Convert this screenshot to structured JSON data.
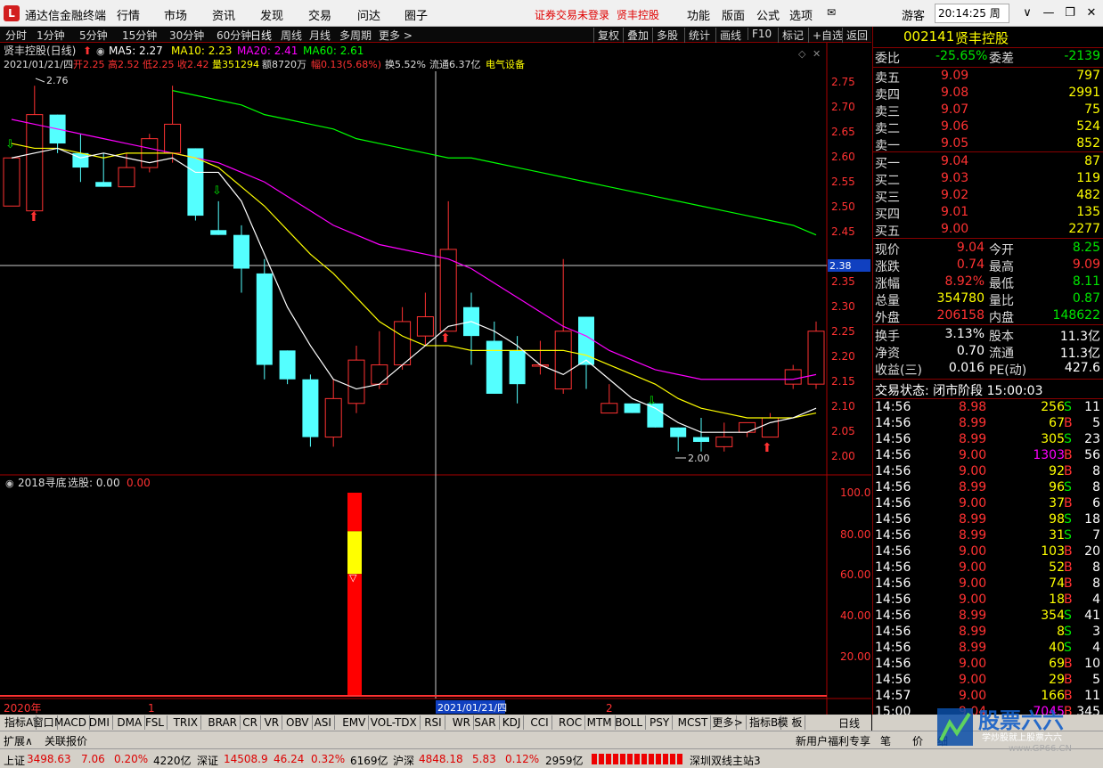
{
  "app": {
    "title": "通达信金融终端",
    "login_notice": "证券交易未登录",
    "stock_link": "贤丰控股",
    "time": "20:14:25 周一"
  },
  "menu": [
    "行情",
    "市场",
    "资讯",
    "发现",
    "交易",
    "问达",
    "圈子"
  ],
  "menu_right": [
    "功能",
    "版面",
    "公式",
    "选项",
    "游客"
  ],
  "periods": [
    "分时",
    "1分钟",
    "5分钟",
    "15分钟",
    "30分钟",
    "60分钟",
    "日线",
    "周线",
    "月线",
    "多周期",
    "更多 >"
  ],
  "active_period": "日线",
  "toolbar_right": [
    "复权",
    "叠加",
    "多股",
    "统计",
    "画线",
    "F10",
    "标记",
    "+自选",
    "返回"
  ],
  "chart_header": {
    "name": "贤丰控股(日线)",
    "ma5": "MA5: 2.27",
    "ma10": "MA10: 2.23",
    "ma20": "MA20: 2.41",
    "ma60": "MA60: 2.61",
    "date": "2021/01/21/四",
    "open": "开2.25",
    "high": "高2.52",
    "low": "低2.25",
    "close": "收2.42",
    "vol": "量351294",
    "amount": "额8720万",
    "change": "幅0.13(5.68%)",
    "turnover": "换5.52%",
    "float": "流通6.37亿",
    "industry": "电气设备"
  },
  "price_axis": [
    "2.75",
    "2.70",
    "2.65",
    "2.60",
    "2.55",
    "2.50",
    "2.45",
    "2.40",
    "2.35",
    "2.30",
    "2.25",
    "2.20",
    "2.15",
    "2.10",
    "2.05",
    "2.00"
  ],
  "crosshair_price": "2.38",
  "max_label": "2.76",
  "min_label": "2.00",
  "indicator_header": {
    "name": "2018寻底",
    "pick": "选股: 0.00",
    "value": "0.00"
  },
  "indicator_axis": [
    "100.0",
    "80.00",
    "60.00",
    "40.00",
    "20.00"
  ],
  "date_axis": {
    "year": "2020年",
    "m1": "1",
    "cross": "2021/01/21/四",
    "m2": "2"
  },
  "chart_data": {
    "type": "candlestick",
    "candles": [
      {
        "o": 2.51,
        "h": 2.61,
        "l": 2.51,
        "c": 2.61
      },
      {
        "o": 2.5,
        "h": 2.76,
        "l": 2.49,
        "c": 2.7
      },
      {
        "o": 2.7,
        "h": 2.7,
        "l": 2.62,
        "c": 2.64
      },
      {
        "o": 2.62,
        "h": 2.66,
        "l": 2.56,
        "c": 2.59
      },
      {
        "o": 2.56,
        "h": 2.62,
        "l": 2.55,
        "c": 2.55
      },
      {
        "o": 2.55,
        "h": 2.62,
        "l": 2.55,
        "c": 2.59
      },
      {
        "o": 2.59,
        "h": 2.66,
        "l": 2.58,
        "c": 2.65
      },
      {
        "o": 2.62,
        "h": 2.76,
        "l": 2.6,
        "c": 2.68
      },
      {
        "o": 2.63,
        "h": 2.63,
        "l": 2.48,
        "c": 2.49
      },
      {
        "o": 2.46,
        "h": 2.52,
        "l": 2.45,
        "c": 2.45
      },
      {
        "o": 2.45,
        "h": 2.47,
        "l": 2.33,
        "c": 2.38
      },
      {
        "o": 2.37,
        "h": 2.4,
        "l": 2.15,
        "c": 2.18
      },
      {
        "o": 2.21,
        "h": 2.21,
        "l": 2.14,
        "c": 2.15
      },
      {
        "o": 2.15,
        "h": 2.16,
        "l": 2.01,
        "c": 2.03
      },
      {
        "o": 2.03,
        "h": 2.15,
        "l": 2.01,
        "c": 2.11
      },
      {
        "o": 2.1,
        "h": 2.22,
        "l": 2.08,
        "c": 2.19
      },
      {
        "o": 2.14,
        "h": 2.25,
        "l": 2.13,
        "c": 2.18
      },
      {
        "o": 2.18,
        "h": 2.3,
        "l": 2.17,
        "c": 2.27
      },
      {
        "o": 2.24,
        "h": 2.33,
        "l": 2.22,
        "c": 2.28
      },
      {
        "o": 2.25,
        "h": 2.52,
        "l": 2.25,
        "c": 2.42
      },
      {
        "o": 2.3,
        "h": 2.33,
        "l": 2.18,
        "c": 2.24
      },
      {
        "o": 2.23,
        "h": 2.27,
        "l": 2.12,
        "c": 2.12
      },
      {
        "o": 2.21,
        "h": 2.24,
        "l": 2.1,
        "c": 2.14
      },
      {
        "o": 2.18,
        "h": 2.23,
        "l": 2.16,
        "c": 2.18
      },
      {
        "o": 2.13,
        "h": 2.4,
        "l": 2.12,
        "c": 2.25
      },
      {
        "o": 2.28,
        "h": 2.28,
        "l": 2.13,
        "c": 2.18
      },
      {
        "o": 2.08,
        "h": 2.14,
        "l": 2.08,
        "c": 2.1
      },
      {
        "o": 2.1,
        "h": 2.1,
        "l": 2.08,
        "c": 2.08
      },
      {
        "o": 2.1,
        "h": 2.1,
        "l": 2.05,
        "c": 2.05
      },
      {
        "o": 2.05,
        "h": 2.05,
        "l": 2.0,
        "c": 2.03
      },
      {
        "o": 2.03,
        "h": 2.07,
        "l": 2.0,
        "c": 2.02
      },
      {
        "o": 2.01,
        "h": 2.06,
        "l": 2.0,
        "c": 2.03
      },
      {
        "o": 2.04,
        "h": 2.06,
        "l": 2.03,
        "c": 2.06
      },
      {
        "o": 2.03,
        "h": 2.08,
        "l": 2.03,
        "c": 2.07
      },
      {
        "o": 2.14,
        "h": 2.18,
        "l": 2.13,
        "c": 2.17
      },
      {
        "o": 2.14,
        "h": 2.27,
        "l": 2.13,
        "c": 2.25
      }
    ],
    "ma5": [
      2.61,
      2.62,
      2.63,
      2.61,
      2.62,
      2.61,
      2.6,
      2.61,
      2.58,
      2.58,
      2.52,
      2.41,
      2.3,
      2.22,
      2.15,
      2.13,
      2.14,
      2.18,
      2.22,
      2.26,
      2.27,
      2.25,
      2.22,
      2.18,
      2.16,
      2.19,
      2.15,
      2.11,
      2.09,
      2.06,
      2.04,
      2.04,
      2.04,
      2.06,
      2.07,
      2.09
    ],
    "ma10": [
      2.64,
      2.63,
      2.63,
      2.62,
      2.61,
      2.62,
      2.62,
      2.62,
      2.61,
      2.59,
      2.55,
      2.51,
      2.46,
      2.41,
      2.37,
      2.32,
      2.27,
      2.24,
      2.22,
      2.22,
      2.21,
      2.21,
      2.21,
      2.21,
      2.21,
      2.2,
      2.18,
      2.16,
      2.14,
      2.11,
      2.09,
      2.08,
      2.07,
      2.07,
      2.07,
      2.08
    ],
    "ma20": [
      2.69,
      2.68,
      2.67,
      2.66,
      2.65,
      2.64,
      2.63,
      2.62,
      2.61,
      2.6,
      2.58,
      2.56,
      2.53,
      2.5,
      2.47,
      2.45,
      2.43,
      2.42,
      2.41,
      2.4,
      2.38,
      2.35,
      2.32,
      2.29,
      2.26,
      2.24,
      2.21,
      2.19,
      2.17,
      2.16,
      2.15,
      2.15,
      2.15,
      2.15,
      2.15,
      2.16
    ],
    "ma60": [
      2.83,
      2.82,
      2.8,
      2.79,
      2.77,
      2.76,
      2.75,
      2.75,
      2.74,
      2.73,
      2.72,
      2.7,
      2.69,
      2.68,
      2.67,
      2.65,
      2.64,
      2.63,
      2.62,
      2.61,
      2.61,
      2.6,
      2.59,
      2.58,
      2.57,
      2.56,
      2.55,
      2.54,
      2.53,
      2.52,
      2.51,
      2.5,
      2.49,
      2.48,
      2.47,
      2.45
    ],
    "indicator": {
      "index": 19,
      "levels": [
        100,
        81,
        60,
        0
      ]
    },
    "ylim": [
      1.97,
      2.79
    ],
    "colors": {
      "up": "#ff3232",
      "down": "#54ffff",
      "ma5": "#ffffff",
      "ma10": "#ffff00",
      "ma20": "#ff00ff",
      "ma60": "#00ff00"
    }
  },
  "quote": {
    "code": "002141",
    "name": "贤丰控股",
    "weibi_label": "委比",
    "weibi": "-25.65%",
    "weicha_label": "委差",
    "weicha": "-2139",
    "asks": [
      {
        "label": "卖五",
        "price": "9.09",
        "vol": "797"
      },
      {
        "label": "卖四",
        "price": "9.08",
        "vol": "2991"
      },
      {
        "label": "卖三",
        "price": "9.07",
        "vol": "75"
      },
      {
        "label": "卖二",
        "price": "9.06",
        "vol": "524"
      },
      {
        "label": "卖一",
        "price": "9.05",
        "vol": "852"
      }
    ],
    "bids": [
      {
        "label": "买一",
        "price": "9.04",
        "vol": "87"
      },
      {
        "label": "买二",
        "price": "9.03",
        "vol": "119"
      },
      {
        "label": "买三",
        "price": "9.02",
        "vol": "482"
      },
      {
        "label": "买四",
        "price": "9.01",
        "vol": "135"
      },
      {
        "label": "买五",
        "price": "9.00",
        "vol": "2277"
      }
    ],
    "stats": [
      {
        "l1": "现价",
        "v1": "9.04",
        "c1": "red",
        "l2": "今开",
        "v2": "8.25",
        "c2": "green"
      },
      {
        "l1": "涨跌",
        "v1": "0.74",
        "c1": "red",
        "l2": "最高",
        "v2": "9.09",
        "c2": "red"
      },
      {
        "l1": "涨幅",
        "v1": "8.92%",
        "c1": "red",
        "l2": "最低",
        "v2": "8.11",
        "c2": "green"
      },
      {
        "l1": "总量",
        "v1": "354780",
        "c1": "yellow",
        "l2": "量比",
        "v2": "0.87",
        "c2": "green"
      },
      {
        "l1": "外盘",
        "v1": "206158",
        "c1": "red",
        "l2": "内盘",
        "v2": "148622",
        "c2": "green"
      }
    ],
    "fin": [
      {
        "l1": "换手",
        "v1": "3.13%",
        "l2": "股本",
        "v2": "11.3亿"
      },
      {
        "l1": "净资",
        "v1": "0.70",
        "l2": "流通",
        "v2": "11.3亿"
      },
      {
        "l1": "收益(三)",
        "v1": "0.016",
        "l2": "PE(动)",
        "v2": "427.6"
      }
    ],
    "trade_status": "交易状态: 闭市阶段  15:00:03",
    "ticks": [
      {
        "t": "14:56",
        "p": "8.98",
        "pc": "red",
        "v": "256",
        "vc": "yellow",
        "s": "S",
        "n": "11"
      },
      {
        "t": "14:56",
        "p": "8.99",
        "pc": "red",
        "v": "67",
        "vc": "yellow",
        "s": "B",
        "n": "5"
      },
      {
        "t": "14:56",
        "p": "8.99",
        "pc": "red",
        "v": "305",
        "vc": "yellow",
        "s": "S",
        "n": "23"
      },
      {
        "t": "14:56",
        "p": "9.00",
        "pc": "red",
        "v": "1303",
        "vc": "magenta",
        "s": "B",
        "n": "56"
      },
      {
        "t": "14:56",
        "p": "9.00",
        "pc": "red",
        "v": "92",
        "vc": "yellow",
        "s": "B",
        "n": "8"
      },
      {
        "t": "14:56",
        "p": "8.99",
        "pc": "red",
        "v": "96",
        "vc": "yellow",
        "s": "S",
        "n": "8"
      },
      {
        "t": "14:56",
        "p": "9.00",
        "pc": "red",
        "v": "37",
        "vc": "yellow",
        "s": "B",
        "n": "6"
      },
      {
        "t": "14:56",
        "p": "8.99",
        "pc": "red",
        "v": "98",
        "vc": "yellow",
        "s": "S",
        "n": "18"
      },
      {
        "t": "14:56",
        "p": "8.99",
        "pc": "red",
        "v": "31",
        "vc": "yellow",
        "s": "S",
        "n": "7"
      },
      {
        "t": "14:56",
        "p": "9.00",
        "pc": "red",
        "v": "103",
        "vc": "yellow",
        "s": "B",
        "n": "20"
      },
      {
        "t": "14:56",
        "p": "9.00",
        "pc": "red",
        "v": "52",
        "vc": "yellow",
        "s": "B",
        "n": "8"
      },
      {
        "t": "14:56",
        "p": "9.00",
        "pc": "red",
        "v": "74",
        "vc": "yellow",
        "s": "B",
        "n": "8"
      },
      {
        "t": "14:56",
        "p": "9.00",
        "pc": "red",
        "v": "18",
        "vc": "yellow",
        "s": "B",
        "n": "4"
      },
      {
        "t": "14:56",
        "p": "8.99",
        "pc": "red",
        "v": "354",
        "vc": "yellow",
        "s": "S",
        "n": "41"
      },
      {
        "t": "14:56",
        "p": "8.99",
        "pc": "red",
        "v": "8",
        "vc": "yellow",
        "s": "S",
        "n": "3"
      },
      {
        "t": "14:56",
        "p": "8.99",
        "pc": "red",
        "v": "40",
        "vc": "yellow",
        "s": "S",
        "n": "4"
      },
      {
        "t": "14:56",
        "p": "9.00",
        "pc": "red",
        "v": "69",
        "vc": "yellow",
        "s": "B",
        "n": "10"
      },
      {
        "t": "14:56",
        "p": "9.00",
        "pc": "red",
        "v": "29",
        "vc": "yellow",
        "s": "B",
        "n": "5"
      },
      {
        "t": "14:57",
        "p": "9.00",
        "pc": "red",
        "v": "166",
        "vc": "yellow",
        "s": "B",
        "n": "11"
      },
      {
        "t": "15:00",
        "p": "9.04",
        "pc": "red",
        "v": "7045",
        "vc": "magenta",
        "s": "B",
        "n": "345"
      }
    ]
  },
  "indicator_tabs": [
    "指标A",
    "窗口",
    "MACD",
    "DMI",
    "DMA",
    "FSL",
    "TRIX",
    "BRAR",
    "CR",
    "VR",
    "OBV",
    "ASI",
    "EMV",
    "VOL-TDX",
    "RSI",
    "WR",
    "SAR",
    "KDJ",
    "CCI",
    "ROC",
    "MTM",
    "BOLL",
    "PSY",
    "MCST",
    "更多",
    ">",
    "指标B",
    "模 板"
  ],
  "right_tabs": {
    "period": "日线"
  },
  "ext": {
    "expand": "扩展∧",
    "related": "关联报价",
    "promo": "新用户福利专享",
    "tab1": "笔",
    "tab2": "价",
    "tab3": "细"
  },
  "status": {
    "sh_label": "上证",
    "sh": "3498.63",
    "sh_chg": "7.06",
    "sh_pct": "0.20%",
    "sh_amt": "4220亿",
    "sz_label": "深证",
    "sz": "14508.9",
    "sz_chg": "46.24",
    "sz_pct": "0.32%",
    "sz_amt": "6169亿",
    "hs_label": "沪深",
    "hs": "4848.18",
    "hs_chg": "5.83",
    "hs_pct": "0.12%",
    "hs_amt": "2959亿",
    "server": "深圳双线主站3"
  },
  "watermark": {
    "brand": "股票六六",
    "sub": "学炒股就上股票六六",
    "site": "www.GP66.CN"
  }
}
